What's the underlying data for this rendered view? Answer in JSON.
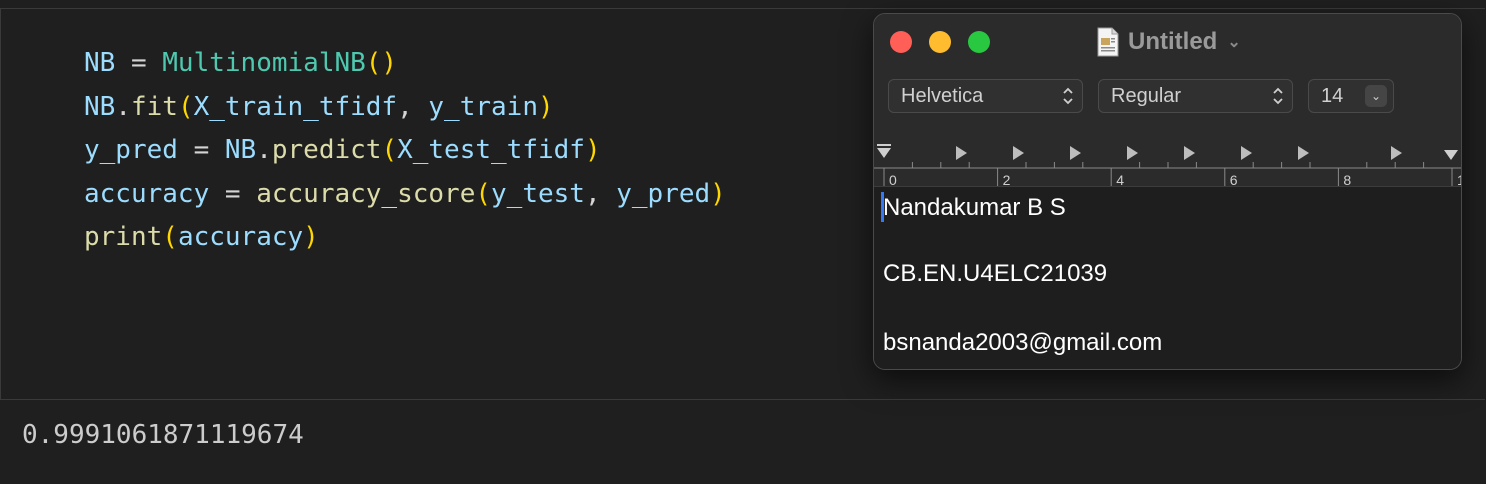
{
  "notebook": {
    "code_lines": [
      [
        {
          "t": "NB",
          "c": "v"
        },
        {
          "t": " = ",
          "c": "o"
        },
        {
          "t": "MultinomialNB",
          "c": "c"
        },
        {
          "t": "()",
          "c": "p"
        }
      ],
      [
        {
          "t": "NB",
          "c": "v"
        },
        {
          "t": ".",
          "c": "o"
        },
        {
          "t": "fit",
          "c": "f"
        },
        {
          "t": "(",
          "c": "p"
        },
        {
          "t": "X_train_tfidf",
          "c": "v"
        },
        {
          "t": ", ",
          "c": "o"
        },
        {
          "t": "y_train",
          "c": "v"
        },
        {
          "t": ")",
          "c": "p"
        }
      ],
      [
        {
          "t": "y_pred",
          "c": "v"
        },
        {
          "t": " = ",
          "c": "o"
        },
        {
          "t": "NB",
          "c": "v"
        },
        {
          "t": ".",
          "c": "o"
        },
        {
          "t": "predict",
          "c": "f"
        },
        {
          "t": "(",
          "c": "p"
        },
        {
          "t": "X_test_tfidf",
          "c": "v"
        },
        {
          "t": ")",
          "c": "p"
        }
      ],
      [
        {
          "t": "accuracy",
          "c": "v"
        },
        {
          "t": " = ",
          "c": "o"
        },
        {
          "t": "accuracy_score",
          "c": "f"
        },
        {
          "t": "(",
          "c": "p"
        },
        {
          "t": "y_test",
          "c": "v"
        },
        {
          "t": ", ",
          "c": "o"
        },
        {
          "t": "y_pred",
          "c": "v"
        },
        {
          "t": ")",
          "c": "p"
        }
      ],
      [
        {
          "t": "print",
          "c": "f"
        },
        {
          "t": "(",
          "c": "p"
        },
        {
          "t": "accuracy",
          "c": "v"
        },
        {
          "t": ")",
          "c": "p"
        }
      ]
    ],
    "output": "0.9991061871119674"
  },
  "textedit": {
    "title": "Untitled",
    "toolbar": {
      "font_family": "Helvetica",
      "font_style": "Regular",
      "font_size": "14"
    },
    "ruler_labels": [
      "0",
      "2",
      "4",
      "6",
      "8",
      "1"
    ],
    "document_lines": [
      "Nandakumar B S",
      "CB.EN.U4ELC21039",
      "bsnanda2003@gmail.com"
    ]
  },
  "colors": {
    "variable": "#9cdcfe",
    "class": "#4ec9b0",
    "function": "#dcdcaa",
    "bracket": "#ffd700",
    "caret": "#3478f6"
  },
  "icons": {
    "close": "close-icon",
    "minimize": "minimize-icon",
    "zoom": "zoom-icon",
    "document": "document-icon",
    "title_menu": "chevron-down-icon"
  }
}
